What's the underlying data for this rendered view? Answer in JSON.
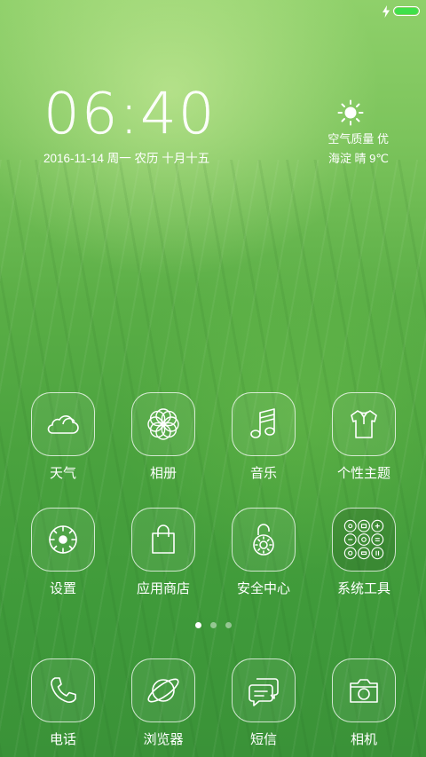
{
  "status_bar": {
    "battery_level": 1.0,
    "charging": true,
    "battery_color": "#3fe04a"
  },
  "lockscreen": {
    "time": "06:40",
    "date": "2016-11-14 周一 农历 十月十五",
    "air_quality": "空气质量 优",
    "weather": "海淀 晴 9℃",
    "weather_icon": "sun-icon"
  },
  "apps": {
    "row1": [
      {
        "label": "天气",
        "icon": "weather-icon"
      },
      {
        "label": "相册",
        "icon": "gallery-icon"
      },
      {
        "label": "音乐",
        "icon": "music-icon"
      },
      {
        "label": "个性主题",
        "icon": "themes-icon"
      }
    ],
    "row2": [
      {
        "label": "设置",
        "icon": "settings-icon"
      },
      {
        "label": "应用商店",
        "icon": "app-store-icon"
      },
      {
        "label": "安全中心",
        "icon": "security-icon"
      },
      {
        "label": "系统工具",
        "icon": "tools-folder-icon"
      }
    ]
  },
  "page_indicator": {
    "pages": 3,
    "current": 1
  },
  "dock": [
    {
      "label": "电话",
      "icon": "phone-icon"
    },
    {
      "label": "浏览器",
      "icon": "browser-icon"
    },
    {
      "label": "短信",
      "icon": "messages-icon"
    },
    {
      "label": "相机",
      "icon": "camera-icon"
    }
  ]
}
